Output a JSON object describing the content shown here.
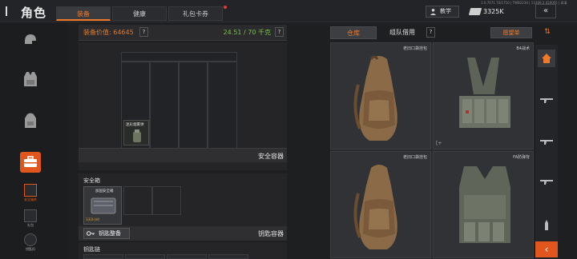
{
  "header": {
    "title": "角色",
    "tabs": [
      {
        "label": "装备",
        "active": true
      },
      {
        "label": "健康",
        "active": false
      },
      {
        "label": "礼包卡券",
        "active": false,
        "notify": true
      }
    ],
    "tiny_info": "1.0.7071 70/1710 | TWB2234 | 13369.2  4200FE | 高清",
    "teach_label": "教学",
    "money": "3325K",
    "close_icon": "double-chevron-left-icon"
  },
  "sidebar": {
    "items": [
      {
        "icon": "helmet-icon"
      },
      {
        "icon": "vest-icon"
      },
      {
        "icon": "backpack-icon"
      },
      {
        "icon": "case-icon",
        "active": true
      }
    ],
    "small": [
      {
        "label": "安全箱库",
        "icon": "safebox-icon"
      },
      {
        "label": "礼包",
        "icon": "gift-icon"
      },
      {
        "label": "钥匙扣",
        "icon": "keyring-icon"
      }
    ]
  },
  "equipment": {
    "value_label": "装备价值: 64645",
    "weight_label": "24.51 / 70 千克",
    "q": "?",
    "grid_item": "迷彩烟雾弹",
    "safe_section_title": "安全容器",
    "safe_label": "安全箱",
    "safe_item_name": "加固安全箱",
    "safe_item_timer": "3天0小时",
    "key_button": "钥匙整备",
    "key_section_title": "钥匙容器",
    "keychain_label": "钥匙链"
  },
  "storage": {
    "tabs": [
      {
        "label": "仓库",
        "active": true
      },
      {
        "label": "组队借用",
        "active": false
      }
    ],
    "q": "?",
    "wish_label": "愿望单",
    "items": [
      {
        "name": "老旧口袋挂包",
        "mark": "",
        "icon": "sack-backpack-icon"
      },
      {
        "name": "B4战术",
        "mark": "[+",
        "icon": "tactical-rig-icon"
      },
      {
        "name": "老旧口袋挂包",
        "mark": "",
        "icon": "sack-backpack-icon"
      },
      {
        "name": "FA防弹背",
        "mark": "",
        "icon": "armor-vest-icon"
      }
    ]
  },
  "rail": {
    "top_icon": "sort-icon",
    "items": [
      "home-icon",
      "rifle-icon",
      "rifle-icon",
      "rifle-icon",
      "rifle-icon",
      "ammo-icon"
    ],
    "bottom_icon": "chevron-left-icon"
  }
}
